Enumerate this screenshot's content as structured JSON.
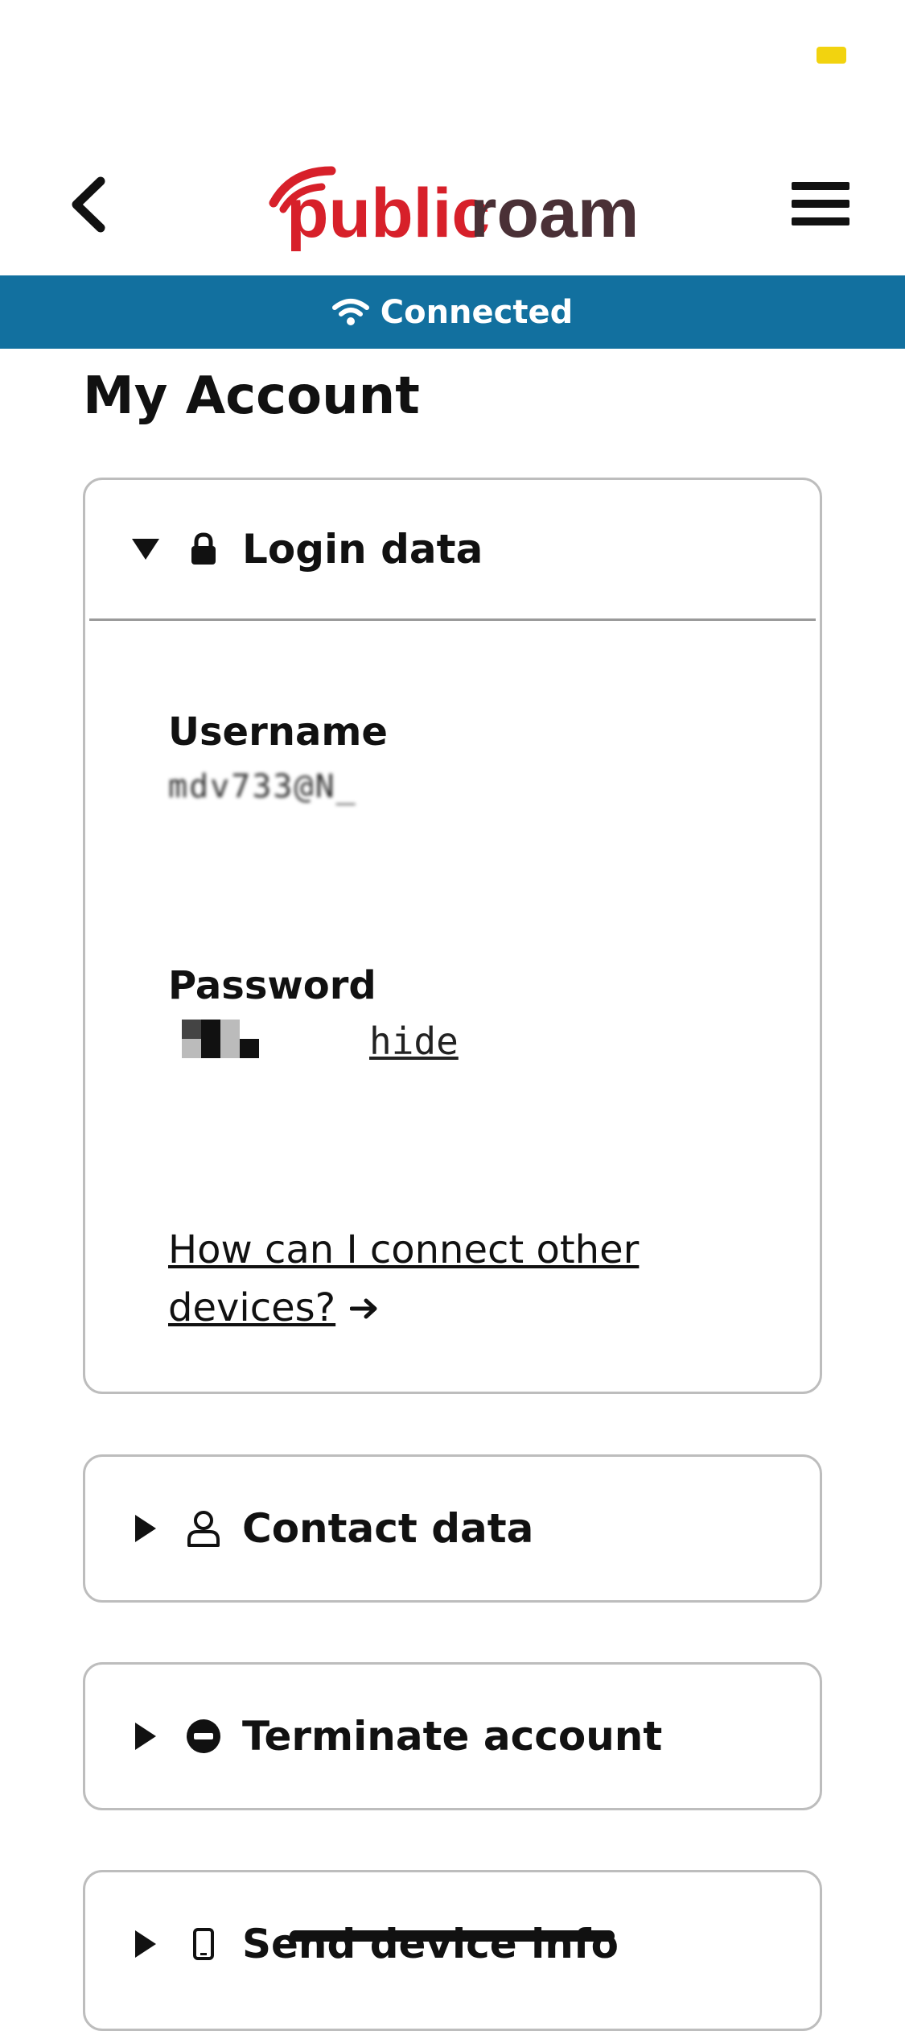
{
  "app": {
    "brand_public": "public",
    "brand_roam": "roam",
    "brand_color_red": "#d7202a",
    "brand_color_dark": "#4a3036"
  },
  "status": {
    "indicator_color": "#f2d30f"
  },
  "connection": {
    "label": "Connected",
    "bar_color": "#12709f"
  },
  "page": {
    "title": "My Account"
  },
  "login": {
    "header": "Login data",
    "username_label": "Username",
    "username_value": "mdv733@N_",
    "password_label": "Password",
    "hide_label": "hide",
    "help_link": "How can I connect other devices?"
  },
  "sections": {
    "contact": "Contact data",
    "terminate": "Terminate account",
    "device": "Send device info"
  },
  "icons": {
    "back": "chevron-left-icon",
    "menu": "hamburger-menu-icon",
    "wifi": "wifi-icon",
    "lock": "lock-icon",
    "user": "user-icon",
    "minus_circle": "minus-circle-icon",
    "phone": "mobile-phone-icon",
    "arrow": "arrow-right-icon"
  }
}
